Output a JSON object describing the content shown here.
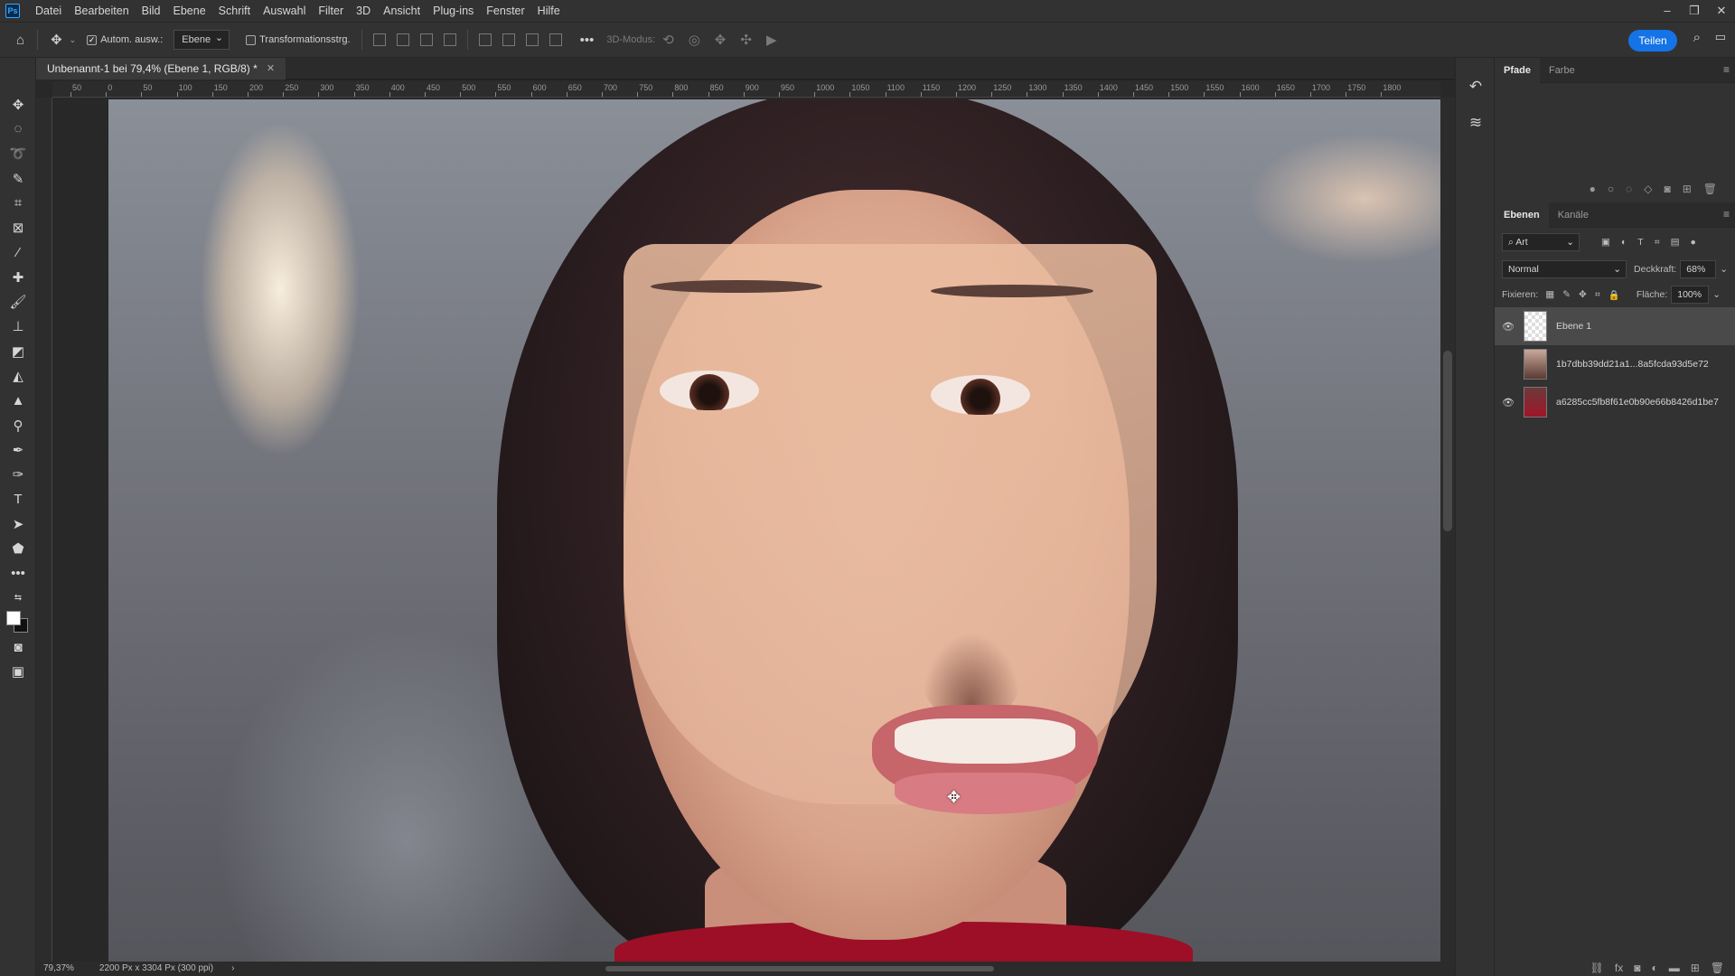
{
  "app": {
    "logo": "Ps"
  },
  "menu": [
    "Datei",
    "Bearbeiten",
    "Bild",
    "Ebene",
    "Schrift",
    "Auswahl",
    "Filter",
    "3D",
    "Ansicht",
    "Plug-ins",
    "Fenster",
    "Hilfe"
  ],
  "options": {
    "auto_select_label": "Autom. ausw.:",
    "auto_select_target": "Ebene",
    "transform_label": "Transformationsstrg.",
    "mode_3d": "3D-Modus:",
    "share_label": "Teilen"
  },
  "document": {
    "tab_title": "Unbenannt-1 bei 79,4% (Ebene 1, RGB/8) *",
    "zoom": "79,37%",
    "doc_info": "2200 Px x 3304 Px (300 ppi)"
  },
  "ruler": [
    "50",
    "0",
    "50",
    "100",
    "150",
    "200",
    "250",
    "300",
    "350",
    "400",
    "450",
    "500",
    "550",
    "600",
    "650",
    "700",
    "750",
    "800",
    "850",
    "900",
    "950",
    "1000",
    "1050",
    "1100",
    "1150",
    "1200",
    "1250",
    "1300",
    "1350",
    "1400",
    "1450",
    "1500",
    "1550",
    "1600",
    "1650",
    "1700",
    "1750",
    "1800"
  ],
  "panels": {
    "top_tabs": [
      "Pfade",
      "Farbe"
    ],
    "layers_tabs": [
      "Ebenen",
      "Kanäle"
    ],
    "filter_label": "Art",
    "blend_mode": "Normal",
    "opacity_label": "Deckkraft:",
    "opacity_value": "68%",
    "lock_label": "Fixieren:",
    "fill_label": "Fläche:",
    "fill_value": "100%",
    "layers": [
      {
        "name": "Ebene 1",
        "visible": true,
        "selected": true
      },
      {
        "name": "1b7dbb39dd21a1...8a5fcda93d5e72",
        "visible": false,
        "selected": false
      },
      {
        "name": "a6285cc5fb8f61e0b90e66b8426d1be7",
        "visible": true,
        "selected": false
      }
    ]
  },
  "colors": {
    "accent": "#1473e6",
    "selected_row": "#4a4a4a"
  }
}
